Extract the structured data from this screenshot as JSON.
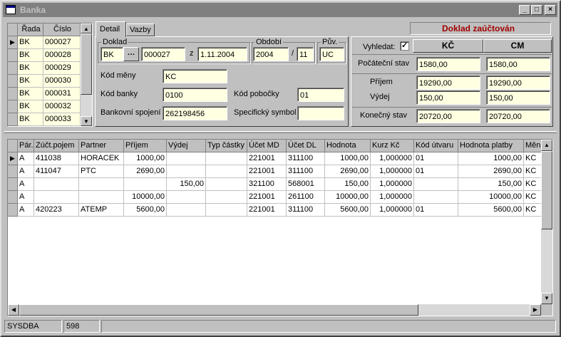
{
  "window": {
    "title": "Banka",
    "minimize": "_",
    "maximize": "□",
    "close": "×"
  },
  "status_banner": "Doklad zaúčtován",
  "series_list": {
    "headers": [
      "Řada",
      "Číslo"
    ],
    "rows": [
      [
        "BK",
        "000027"
      ],
      [
        "BK",
        "000028"
      ],
      [
        "BK",
        "000029"
      ],
      [
        "BK",
        "000030"
      ],
      [
        "BK",
        "000031"
      ],
      [
        "BK",
        "000032"
      ],
      [
        "BK",
        "000033"
      ]
    ]
  },
  "tabs": [
    "Detail",
    "Vazby"
  ],
  "doklad": {
    "group_label": "Doklad",
    "series": "BK",
    "ellipsis": "…",
    "number": "000027",
    "date_prefix": "z",
    "date": "1.11.2004",
    "period_label": "Období",
    "period_year": "2004",
    "period_sep": "/",
    "period_month": "11",
    "origin_label": "Pův.",
    "origin": "UC"
  },
  "details": {
    "currency_label": "Kód měny",
    "currency": "KC",
    "bank_label": "Kód banky",
    "bank": "0100",
    "branch_label": "Kód pobočky",
    "branch": "01",
    "account_label": "Bankovní spojení",
    "account": "262198456",
    "symbol_label": "Specifický symbol",
    "symbol": ""
  },
  "summary": {
    "search_label": "Vyhledat:",
    "search_check": "✓",
    "col1": "KČ",
    "col2": "CM",
    "opening_label": "Počáteční stav",
    "opening": [
      "1580,00",
      "1580,00"
    ],
    "income_label": "Příjem",
    "income": [
      "19290,00",
      "19290,00"
    ],
    "expense_label": "Výdej",
    "expense": [
      "150,00",
      "150,00"
    ],
    "closing_label": "Konečný stav",
    "closing": [
      "20720,00",
      "20720,00"
    ]
  },
  "main_grid": {
    "headers": [
      "Pár.",
      "Zúčt.pojem",
      "Partner",
      "Příjem",
      "Výdej",
      "Typ částky",
      "Účet MD",
      "Účet DL",
      "Hodnota",
      "Kurz Kč",
      "Kód útvaru",
      "Hodnota platby",
      "Měna"
    ],
    "rows": [
      [
        "A",
        "411038",
        "HORACEK",
        "1000,00",
        "",
        "",
        "221001",
        "311100",
        "1000,00",
        "1,000000",
        "01",
        "1000,00",
        "KC"
      ],
      [
        "A",
        "411047",
        "PTC",
        "2690,00",
        "",
        "",
        "221001",
        "311100",
        "2690,00",
        "1,000000",
        "01",
        "2690,00",
        "KC"
      ],
      [
        "A",
        "",
        "",
        "",
        "150,00",
        "",
        "321100",
        "568001",
        "150,00",
        "1,000000",
        "",
        "150,00",
        "KC"
      ],
      [
        "A",
        "",
        "",
        "10000,00",
        "",
        "",
        "221001",
        "261100",
        "10000,00",
        "1,000000",
        "",
        "10000,00",
        "KC"
      ],
      [
        "A",
        "420223",
        "ATEMP",
        "5600,00",
        "",
        "",
        "221001",
        "311100",
        "5600,00",
        "1,000000",
        "01",
        "5600,00",
        "KC"
      ]
    ]
  },
  "statusbar": [
    "SYSDBA",
    "598"
  ],
  "colors": {
    "banner_text": "#a00000",
    "field_bg": "#ffffe1",
    "face": "#c0c0c0"
  }
}
